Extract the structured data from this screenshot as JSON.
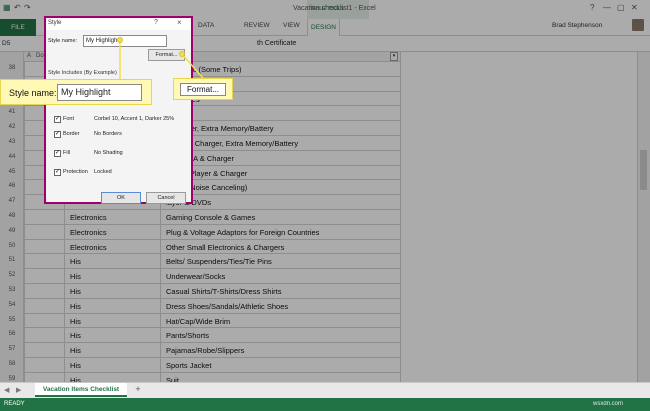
{
  "window": {
    "title": "Vacation checklist1 - Excel",
    "table_tools": "TABLE TOOLS",
    "user_name": "Brad Stephenson",
    "tabs": [
      "FILE",
      "DATA",
      "REVIEW",
      "VIEW",
      "DESIGN"
    ]
  },
  "formula_bar": {
    "name_box": "D5",
    "text": "th Certificate"
  },
  "filter_header": {
    "col_a": "A",
    "col_a_label": "Done"
  },
  "rows": [
    {
      "num": "38",
      "category": "",
      "item": "Antibiotic (Some Trips)"
    },
    {
      "num": "39",
      "category": "",
      "item": ""
    },
    {
      "num": "40",
      "category": "",
      "item": "Remedies"
    },
    {
      "num": "41",
      "category": "",
      "item": "rger"
    },
    {
      "num": "42",
      "category": "",
      "item": ", Charger, Extra Memory/Battery"
    },
    {
      "num": "43",
      "category": "",
      "item": "Manual, Charger, Extra Memory/Battery"
    },
    {
      "num": "44",
      "category": "",
      "item": "ptop/PDA & Charger"
    },
    {
      "num": "45",
      "category": "",
      "item": "/Music Player & Charger"
    },
    {
      "num": "46",
      "category": "",
      "item": "ar Bud/Noise Canceling)"
    },
    {
      "num": "47",
      "category": "",
      "item": "layer & DVDs"
    },
    {
      "num": "48",
      "category": "Electronics",
      "item": "Gaming Console & Games"
    },
    {
      "num": "49",
      "category": "Electronics",
      "item": "Plug & Voltage Adaptors for Foreign Countries"
    },
    {
      "num": "50",
      "category": "Electronics",
      "item": "Other Small Electronics & Chargers"
    },
    {
      "num": "51",
      "category": "His",
      "item": "Belts/ Suspenders/Ties/Tie Pins"
    },
    {
      "num": "52",
      "category": "His",
      "item": "Underwear/Socks"
    },
    {
      "num": "53",
      "category": "His",
      "item": "Casual Shirts/T-Shirts/Dress Shirts"
    },
    {
      "num": "54",
      "category": "His",
      "item": "Dress Shoes/Sandals/Athletic Shoes"
    },
    {
      "num": "55",
      "category": "His",
      "item": "Hat/Cap/Wide Brim"
    },
    {
      "num": "56",
      "category": "His",
      "item": "Pants/Shorts"
    },
    {
      "num": "57",
      "category": "His",
      "item": "Pajamas/Robe/Slippers"
    },
    {
      "num": "58",
      "category": "His",
      "item": "Sports Jacket"
    },
    {
      "num": "59",
      "category": "His",
      "item": "Suit"
    }
  ],
  "dialog": {
    "title": "Style",
    "help": "?",
    "close": "×",
    "style_name_label": "Style name:",
    "style_name_value": "My Highlight",
    "format_button": "Format...",
    "includes_label": "Style Includes (By Example)",
    "alignment_value": "ottom Aligned",
    "options": [
      {
        "label": "Font",
        "value": "Corbel 10, Accent 1, Darker 25%",
        "checked": true
      },
      {
        "label": "Border",
        "value": "No Borders",
        "checked": true
      },
      {
        "label": "Fill",
        "value": "No Shading",
        "checked": true
      },
      {
        "label": "Protection",
        "value": "Locked",
        "checked": true
      }
    ],
    "ok_button": "OK",
    "cancel_button": "Cancel"
  },
  "callouts": {
    "style_name_label": "Style name:",
    "style_name_value": "My Highlight",
    "format_button": "Format..."
  },
  "sheet": {
    "tab": "Vacation Items Checklist",
    "add": "+"
  },
  "status": {
    "text": "READY"
  },
  "watermark": "wsxdn.com",
  "colors": {
    "excel_green": "#217346",
    "dialog_border": "#a0006e",
    "callout_fill": "#fff9b5"
  }
}
